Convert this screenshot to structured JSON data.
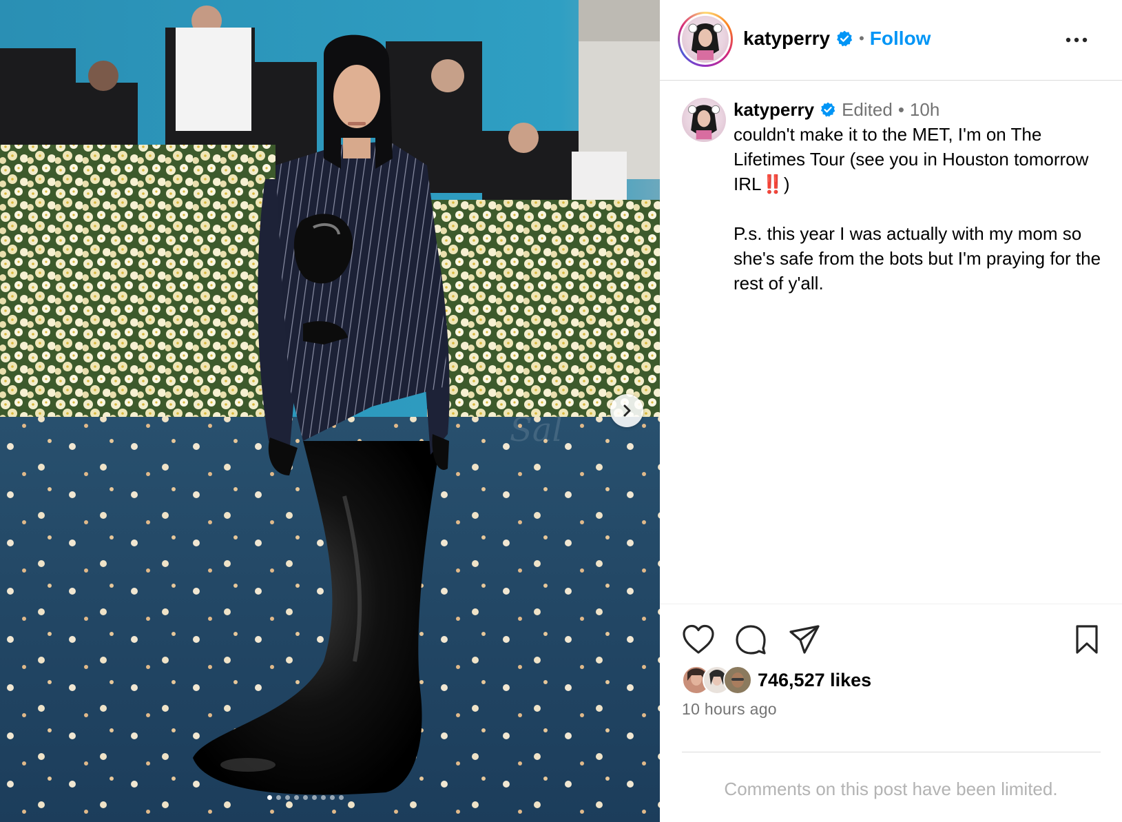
{
  "header": {
    "username": "katyperry",
    "separator": "•",
    "follow_label": "Follow"
  },
  "post": {
    "username": "katyperry",
    "edited_label": "Edited",
    "separator": "•",
    "time": "10h",
    "caption_part1": "couldn't make it to the MET, I'm on The Lifetimes Tour (see you in Houston tomorrow IRL",
    "caption_bangs": "‼️",
    "caption_part2": ")\n\nP.s. this year I was actually with my mom so she's safe from the bots but I'm praying for the rest of y'all.",
    "likes": "746,527 likes",
    "posted_ago": "10 hours ago",
    "comments_notice": "Comments on this post have been limited."
  },
  "carousel": {
    "slide_count": 9,
    "active_index": 0
  },
  "icons": {
    "verified": "verified-badge-icon",
    "more": "more-options-icon",
    "like": "heart-icon",
    "comment": "comment-icon",
    "share": "share-icon",
    "save": "bookmark-icon",
    "next": "chevron-right-icon"
  },
  "colors": {
    "follow": "#0095f6",
    "verified": "#0095f6",
    "muted": "#737373",
    "limited_text": "#b3b3b3"
  }
}
